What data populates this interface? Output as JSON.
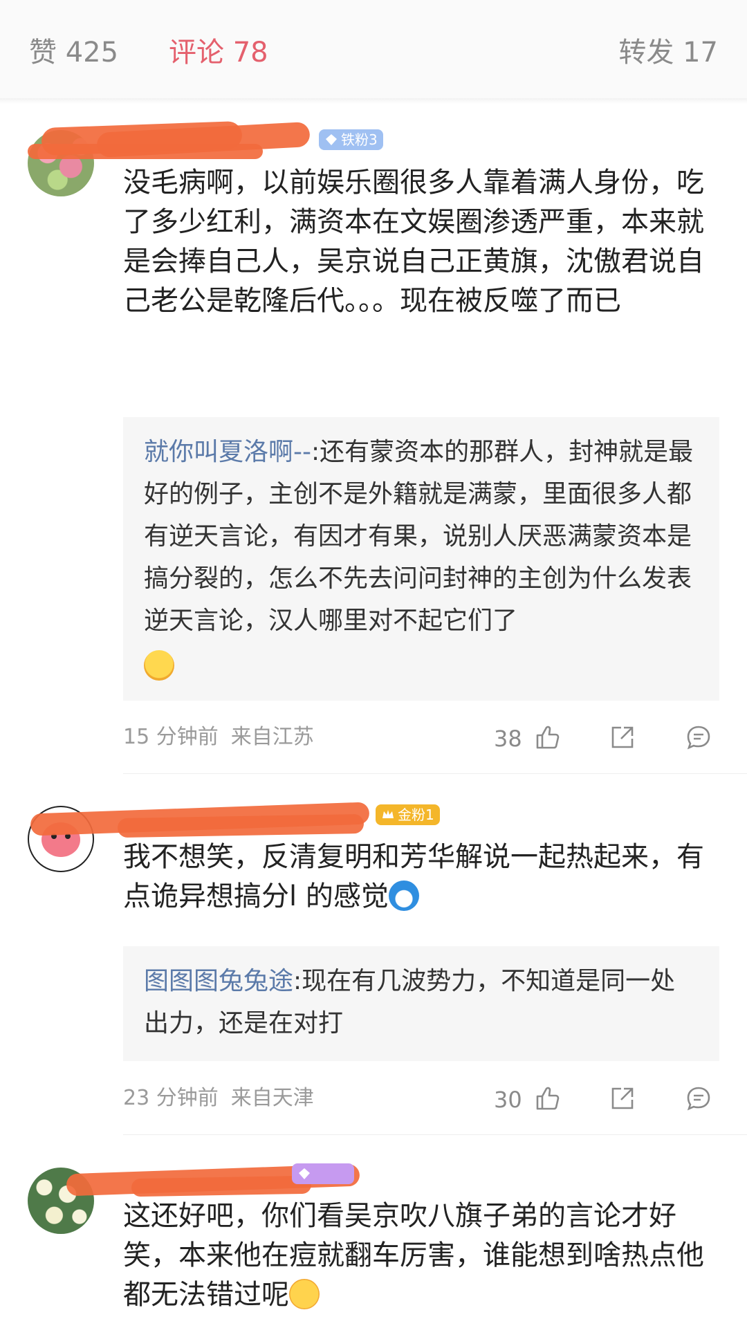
{
  "tabs": {
    "likes": "赞 425",
    "comments": "评论 78",
    "reposts": "转发 17"
  },
  "colors": {
    "accent": "#e4606d",
    "reply_user": "#5b7aa9",
    "redaction": "#f26a3c"
  },
  "comments": [
    {
      "badge": "铁粉3",
      "text": "没毛病啊，以前娱乐圈很多人靠着满人身份，吃了多少红利，满资本在文娱圈渗透严重，本来就是会捧自己人，吴京说自己正黄旗，沈傲君说自己老公是乾隆后代。。。现在被反噬了而已",
      "reply": {
        "user": "就你叫夏洛啊--",
        "sep": ":",
        "text": "还有蒙资本的那群人，封神就是最好的例子，主创不是外籍就是满蒙，里面很多人都有逆天言论，有因才有果，说别人厌恶满蒙资本是搞分裂的，怎么不先去问问封神的主创为什么发表逆天言论，汉人哪里对不起它们了",
        "emoji": "sweat-emoji"
      },
      "time": "15 分钟前",
      "location": "来自江苏",
      "likes": "38"
    },
    {
      "badge": "金粉1",
      "text": "我不想笑，反清复明和芳华解说一起热起来，有点诡异想搞分l 的感觉",
      "emoji": "doraemon-emoji",
      "reply": {
        "user": "图图图兔兔途",
        "sep": ":",
        "text": "现在有几波势力，不知道是同一处出力，还是在对打"
      },
      "time": "23 分钟前",
      "location": "来自天津",
      "likes": "30"
    },
    {
      "text": "这还好吧，你们看吴京吹八旗子弟的言论才好笑，本来他在痘就翻车厉害，谁能想到啥热点他都无法错过呢",
      "emoji": "crying-laughing-emoji"
    }
  ]
}
